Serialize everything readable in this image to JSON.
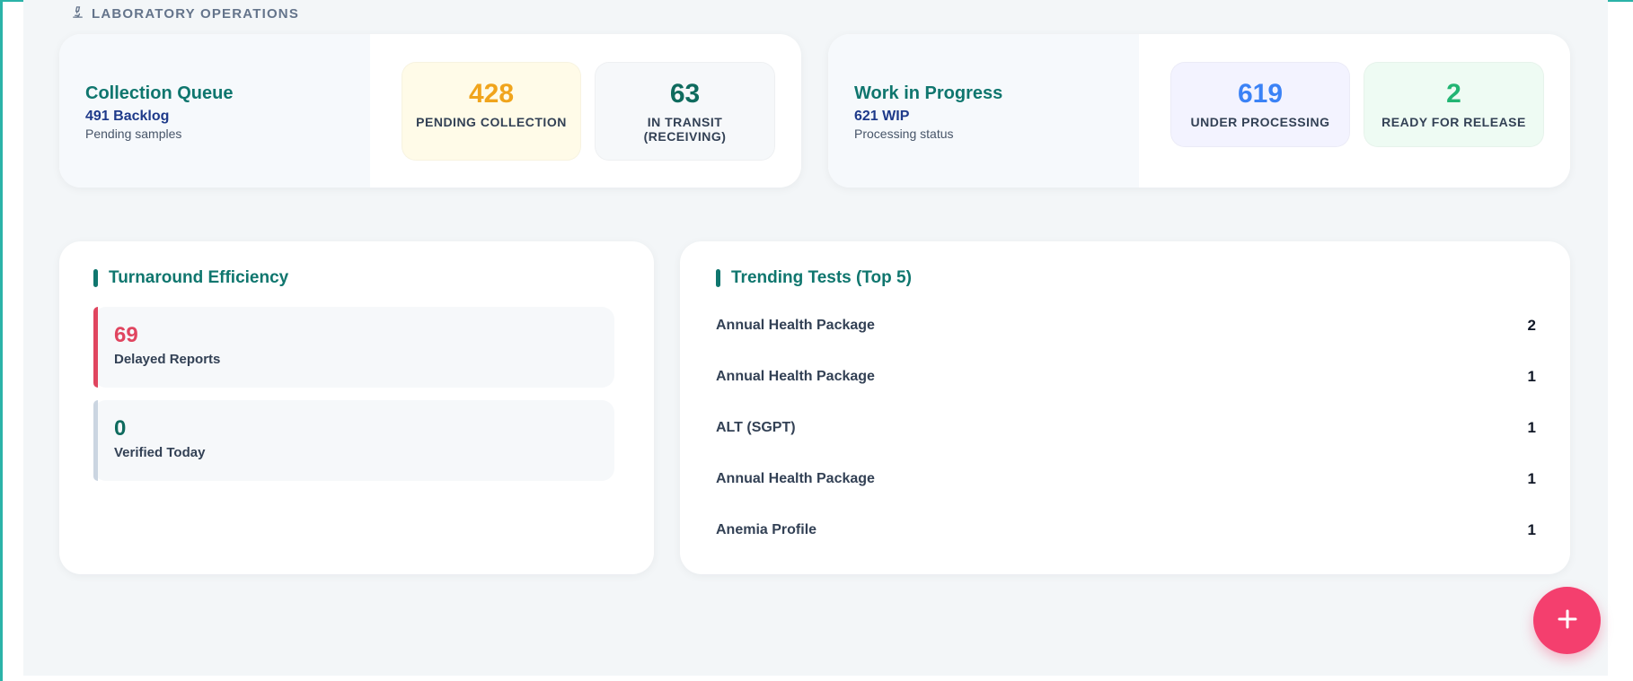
{
  "section": {
    "label": "Laboratory Operations",
    "icon": "microscope-icon"
  },
  "collection": {
    "title": "Collection Queue",
    "sub": "491 Backlog",
    "desc": "Pending samples",
    "tiles": [
      {
        "value": "428",
        "label": "Pending Collection",
        "color": "#f0a41c",
        "bg": "#fffbe8"
      },
      {
        "value": "63",
        "label": "In Transit (Receiving)",
        "color": "#0f6b5e",
        "bg": "#f6f8fa"
      }
    ]
  },
  "wip": {
    "title": "Work in Progress",
    "sub": "621 WIP",
    "desc": "Processing status",
    "tiles": [
      {
        "value": "619",
        "label": "Under Processing",
        "color": "#3b82f6",
        "bg": "#f3f3ff"
      },
      {
        "value": "2",
        "label": "Ready for Release",
        "color": "#22b573",
        "bg": "#eefbf3"
      }
    ]
  },
  "turnaround": {
    "title": "Turnaround Efficiency",
    "metrics": [
      {
        "value": "69",
        "label": "Delayed Reports",
        "color": "#e0455f",
        "accent": "#e0455f"
      },
      {
        "value": "0",
        "label": "Verified Today",
        "color": "#0f6b5e",
        "accent": "#cbd5e1"
      }
    ]
  },
  "trending": {
    "title": "Trending Tests (Top 5)",
    "items": [
      {
        "name": "Annual Health Package",
        "count": "2"
      },
      {
        "name": "Annual Health Package",
        "count": "1"
      },
      {
        "name": "ALT (SGPT)",
        "count": "1"
      },
      {
        "name": "Annual Health Package",
        "count": "1"
      },
      {
        "name": "Anemia Profile",
        "count": "1"
      }
    ]
  },
  "fab": {
    "icon": "plus-icon",
    "color": "#f43f6e"
  }
}
